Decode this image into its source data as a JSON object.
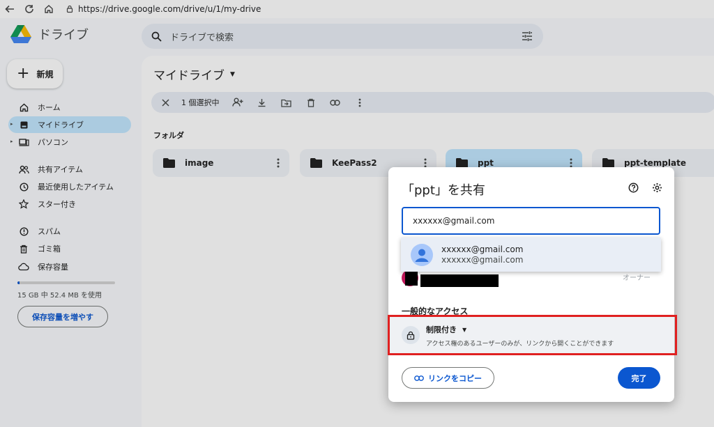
{
  "browser": {
    "url": "https://drive.google.com/drive/u/1/my-drive"
  },
  "app": {
    "name": "ドライブ",
    "search_placeholder": "ドライブで検索",
    "new_label": "新規"
  },
  "sidebar": {
    "items": [
      {
        "label": "ホーム",
        "icon": "home-icon"
      },
      {
        "label": "マイドライブ",
        "icon": "my-drive-icon",
        "active": true
      },
      {
        "label": "パソコン",
        "icon": "computer-icon"
      },
      {
        "label": "共有アイテム",
        "icon": "shared-icon"
      },
      {
        "label": "最近使用したアイテム",
        "icon": "clock-icon"
      },
      {
        "label": "スター付き",
        "icon": "star-icon"
      },
      {
        "label": "スパム",
        "icon": "spam-icon"
      },
      {
        "label": "ゴミ箱",
        "icon": "trash-icon"
      },
      {
        "label": "保存容量",
        "icon": "cloud-icon"
      }
    ],
    "storage_text": "15 GB 中 52.4 MB を使用",
    "storage_fraction": 0.0035,
    "storage_button": "保存容量を増やす"
  },
  "main": {
    "title": "マイドライブ",
    "selection_text": "1 個選択中",
    "folders_label": "フォルダ",
    "folders": [
      {
        "name": "image"
      },
      {
        "name": "KeePass2"
      },
      {
        "name": "ppt",
        "selected": true
      },
      {
        "name": "ppt-template"
      }
    ]
  },
  "dialog": {
    "title": "「ppt」を共有",
    "input_value": "xxxxxx@gmail.com",
    "suggestion_name": "xxxxxx@gmail.com",
    "suggestion_email": "xxxxxx@gmail.com",
    "owner_role": "オーナー",
    "general_access_header": "一般的なアクセス",
    "access_level": "制限付き",
    "access_description": "アクセス権のあるユーザーのみが、リンクから開くことができます",
    "copy_link_label": "リンクをコピー",
    "done_label": "完了"
  },
  "colors": {
    "accent": "#0b57d0",
    "selected": "#c2e7ff",
    "highlight": "#e02020"
  }
}
